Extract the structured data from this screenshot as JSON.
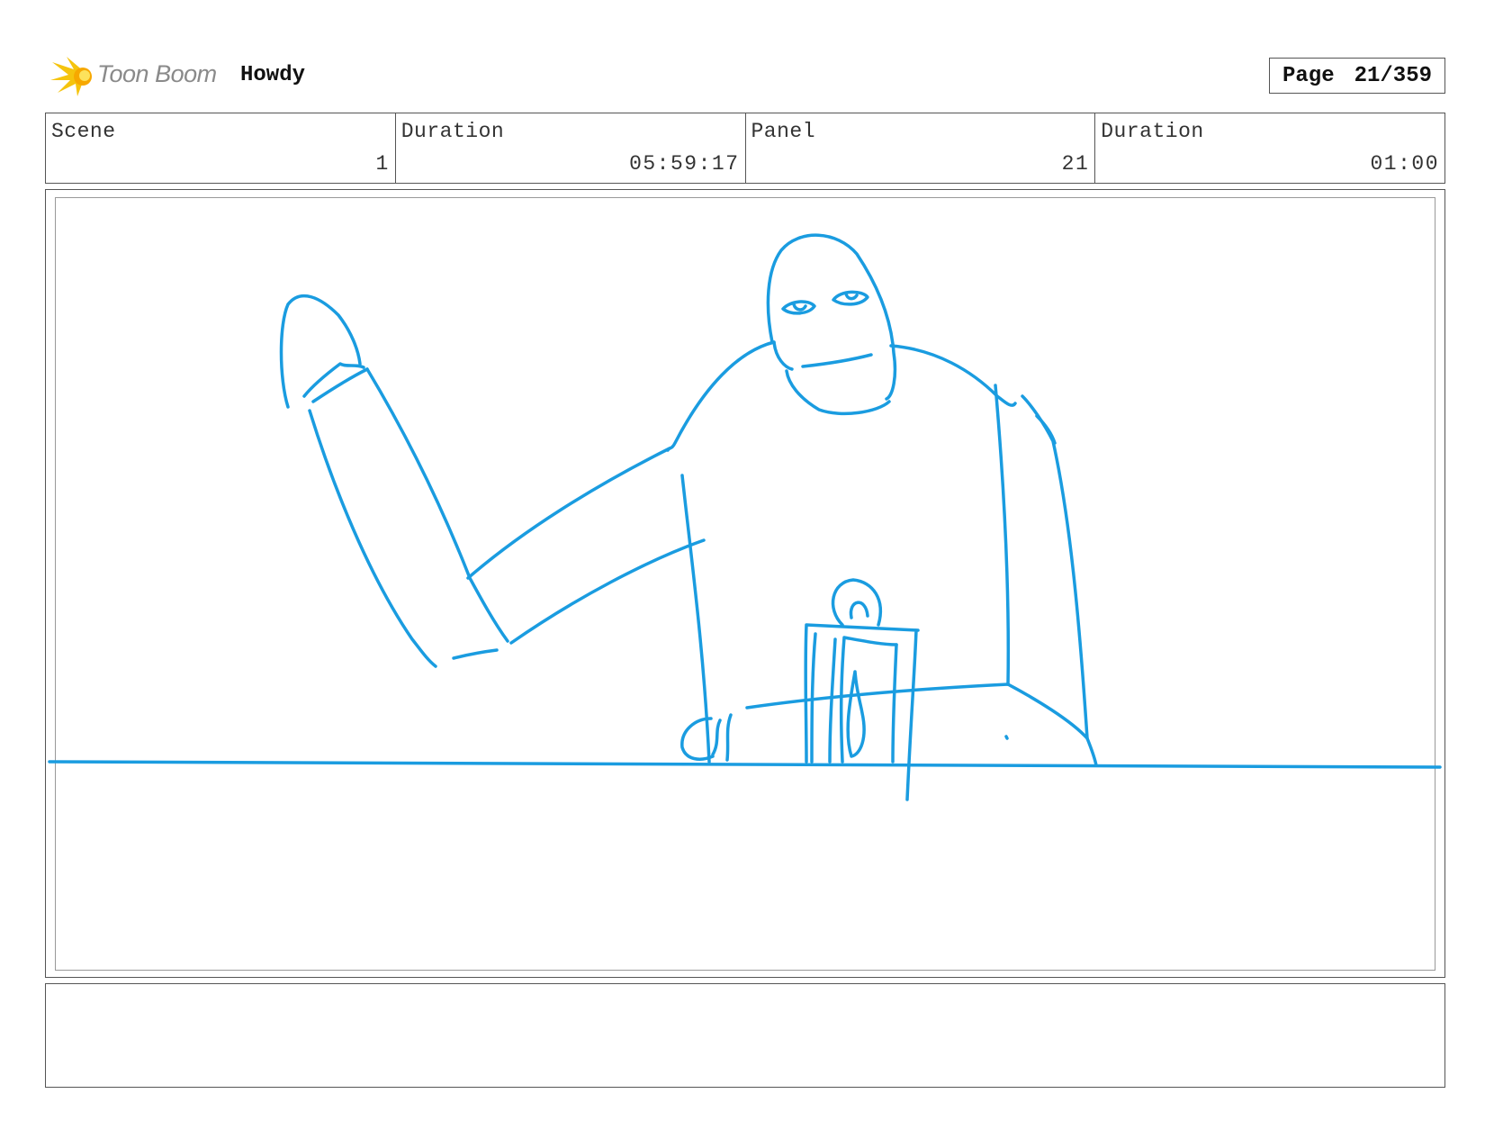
{
  "header": {
    "brand": "Toon Boom",
    "logo_icon": "starburst-icon",
    "project_name": "Howdy",
    "page_label": "Page",
    "page_number": "21/359"
  },
  "info": {
    "scene_label": "Scene",
    "scene_value": "1",
    "scene_duration_label": "Duration",
    "scene_duration_value": "05:59:17",
    "panel_label": "Panel",
    "panel_value": "21",
    "panel_duration_label": "Duration",
    "panel_duration_value": "01:00"
  },
  "sketch": {
    "stroke_color": "#1a9ce0"
  },
  "notes": {
    "text": ""
  }
}
